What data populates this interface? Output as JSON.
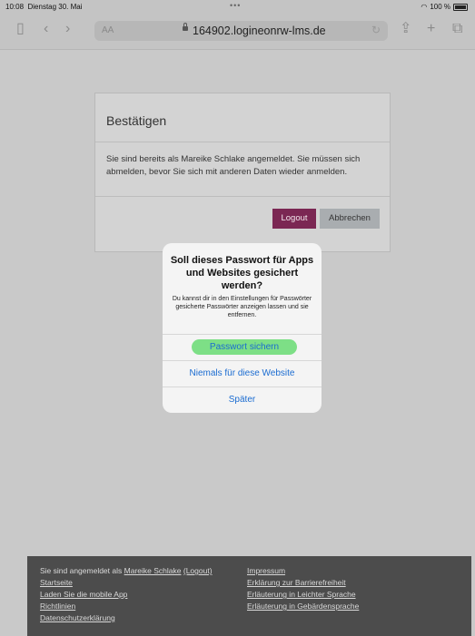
{
  "status": {
    "time": "10:08",
    "date": "Dienstag 30. Mai",
    "battery": "100 %"
  },
  "browser": {
    "text_size": "AA",
    "url": "164902.logineonrw-lms.de"
  },
  "dialog": {
    "title": "Bestätigen",
    "message": "Sie sind bereits als Mareike Schlake angemeldet. Sie müssen sich abmelden, bevor Sie sich mit anderen Daten wieder anmelden.",
    "logout_label": "Logout",
    "cancel_label": "Abbrechen"
  },
  "password_prompt": {
    "title": "Soll dieses Passwort für Apps und Websites gesichert werden?",
    "description": "Du kannst dir in den Einstellungen für Passwörter gesicherte Passwörter anzeigen lassen und sie entfernen.",
    "save_label": "Passwort sichern",
    "never_label": "Niemals für diese Website",
    "later_label": "Später"
  },
  "footer": {
    "logged_in_prefix": "Sie sind angemeldet als",
    "user_name": "Mareike Schlake",
    "logout_link": "(Logout)",
    "left_links": [
      "Startseite",
      "Laden Sie die mobile App",
      "Richtlinien",
      "Datenschutzerklärung"
    ],
    "right_links": [
      "Impressum",
      "Erklärung zur Barrierefreiheit",
      "Erläuterung in Leichter Sprache",
      "Erläuterung in Gebärdensprache"
    ]
  }
}
